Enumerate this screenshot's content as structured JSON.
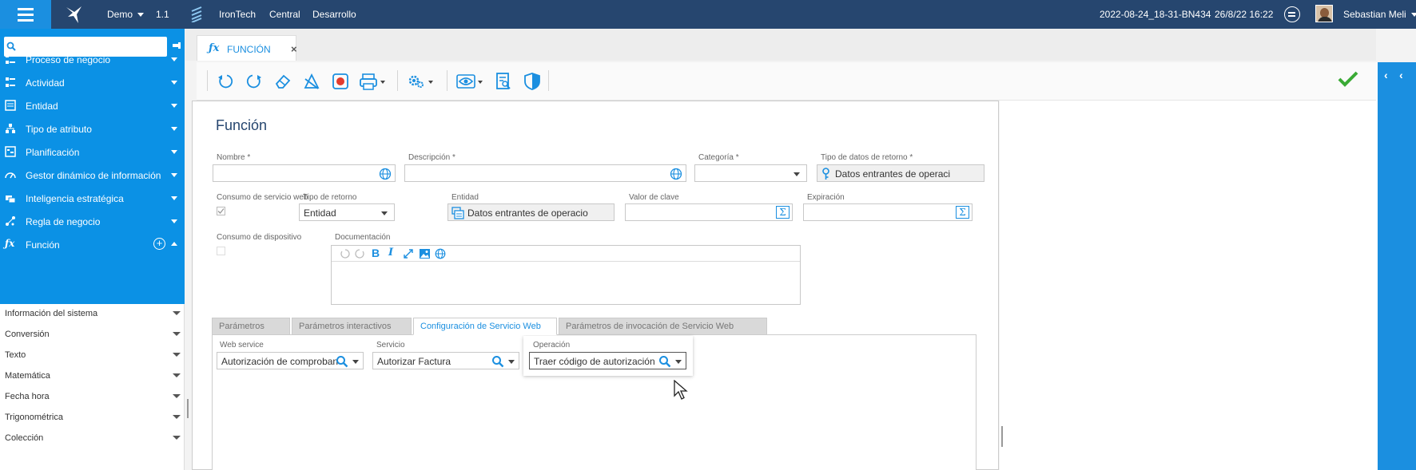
{
  "topbar": {
    "app": "Demo",
    "version": "1.1",
    "nav": [
      "IronTech",
      "Central",
      "Desarrollo"
    ],
    "build": "2022-08-24_18-31-BN434",
    "datetime": "26/8/22 16:22",
    "user": "Sebastian Meli"
  },
  "sidebar": {
    "search_placeholder": "",
    "items": [
      {
        "label": "Proceso de negocio",
        "icon": "process-icon"
      },
      {
        "label": "Actividad",
        "icon": "activity-icon"
      },
      {
        "label": "Entidad",
        "icon": "entity-icon"
      },
      {
        "label": "Tipo de atributo",
        "icon": "attribute-type-icon"
      },
      {
        "label": "Planificación",
        "icon": "planning-icon"
      },
      {
        "label": "Gestor dinámico de información",
        "icon": "dashboard-icon"
      },
      {
        "label": "Inteligencia estratégica",
        "icon": "intelligence-icon"
      },
      {
        "label": "Regla de negocio",
        "icon": "rule-icon"
      },
      {
        "label": "Función",
        "icon": "function-icon"
      }
    ],
    "sub_items": [
      "Información del sistema",
      "Conversión",
      "Texto",
      "Matemática",
      "Fecha hora",
      "Trigonométrica",
      "Colección"
    ]
  },
  "tab": {
    "label": "FUNCIÓN",
    "fx": "ƒx"
  },
  "form": {
    "title": "Función",
    "nombre_label": "Nombre",
    "nombre_value": "",
    "descripcion_label": "Descripción",
    "descripcion_value": "",
    "categoria_label": "Categoría",
    "categoria_value": "",
    "tipo_datos_retorno_label": "Tipo de datos de retorno",
    "tipo_datos_retorno_value": "Datos entrantes de operaci",
    "consumo_ws_label": "Consumo de servicio web",
    "tipo_retorno_label": "Tipo de retorno",
    "tipo_retorno_value": "Entidad",
    "entidad_label": "Entidad",
    "entidad_value": "Datos entrantes de operacio",
    "valor_clave_label": "Valor de clave",
    "valor_clave_value": "",
    "expiracion_label": "Expiración",
    "expiracion_value": "",
    "consumo_dispositivo_label": "Consumo de dispositivo",
    "documentacion_label": "Documentación",
    "required_mark": "*"
  },
  "tabs": [
    "Parámetros",
    "Parámetros interactivos",
    "Configuración de Servicio Web",
    "Parámetros de invocación de Servicio Web"
  ],
  "webservice": {
    "web_service_label": "Web service",
    "web_service_value": "Autorización de comprobantes",
    "servicio_label": "Servicio",
    "servicio_value": "Autorizar Factura",
    "operacion_label": "Operación",
    "operacion_value": "Traer código de autorización"
  },
  "colors": {
    "topbar": "#26466f",
    "accent": "#1b8fe0",
    "sidebar": "#0b91e5",
    "success": "#3aaa35"
  }
}
